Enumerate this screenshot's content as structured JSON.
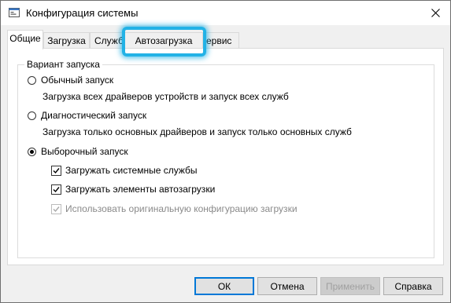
{
  "window": {
    "title": "Конфигурация системы",
    "close_icon": "close-icon",
    "app_icon": "msconfig-icon"
  },
  "tabs": [
    {
      "label": "Общие",
      "active": true
    },
    {
      "label": "Загрузка",
      "active": false
    },
    {
      "label": "Служб",
      "active": false
    },
    {
      "label": "Автозагрузка",
      "active": false,
      "highlighted": true
    },
    {
      "label": "ервис",
      "active": false
    }
  ],
  "general": {
    "group_label": "Вариант запуска",
    "normal": {
      "label": "Обычный запуск",
      "description": "Загрузка всех драйверов устройств и запуск всех служб",
      "selected": false
    },
    "diagnostic": {
      "label": "Диагностический запуск",
      "description": "Загрузка только основных драйверов и запуск только основных служб",
      "selected": false
    },
    "selective": {
      "label": "Выборочный запуск",
      "selected": true,
      "options": [
        {
          "label": "Загружать системные службы",
          "checked": true,
          "enabled": true
        },
        {
          "label": "Загружать элементы автозагрузки",
          "checked": true,
          "enabled": true
        },
        {
          "label": "Использовать оригинальную конфигурацию загрузки",
          "checked": true,
          "enabled": false
        }
      ]
    }
  },
  "buttons": {
    "ok": "ОК",
    "cancel": "Отмена",
    "apply": "Применить",
    "help": "Справка"
  },
  "colors": {
    "highlight": "#22b2e6",
    "accent": "#0078d7"
  }
}
